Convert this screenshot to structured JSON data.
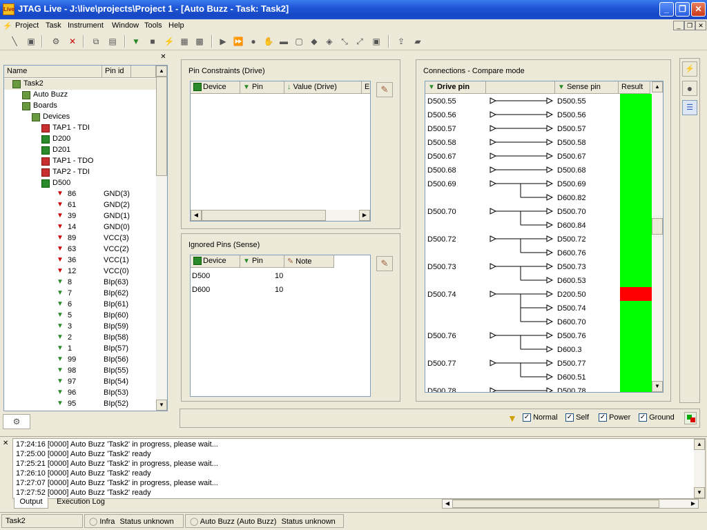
{
  "window": {
    "title": "JTAG Live - J:\\live\\projects\\Project 1 - [Auto Buzz - Task: Task2]",
    "logo": "Live",
    "minimize": "_",
    "restore": "❐",
    "close": "✕"
  },
  "menu": [
    "Project",
    "Task",
    "Instrument",
    "Window",
    "Tools",
    "Help"
  ],
  "tree": {
    "columns": [
      "Name",
      "Pin id"
    ],
    "rows": [
      {
        "label": "Task2",
        "pin": "",
        "level": 0,
        "icon": "task-icon"
      },
      {
        "label": "Auto Buzz",
        "pin": "",
        "level": 1,
        "icon": "autobuzz-icon"
      },
      {
        "label": "Boards",
        "pin": "",
        "level": 1,
        "icon": "boards-icon"
      },
      {
        "label": "Devices",
        "pin": "",
        "level": 2,
        "icon": "devices-icon"
      },
      {
        "label": "TAP1 - TDI",
        "pin": "",
        "level": 3,
        "icon": "tap-icon"
      },
      {
        "label": "D200",
        "pin": "",
        "level": 3,
        "icon": "chip-icon"
      },
      {
        "label": "D201",
        "pin": "",
        "level": 3,
        "icon": "chip-icon"
      },
      {
        "label": "TAP1 - TDO",
        "pin": "",
        "level": 3,
        "icon": "tap-icon"
      },
      {
        "label": "TAP2 - TDI",
        "pin": "",
        "level": 3,
        "icon": "tap-icon"
      },
      {
        "label": "D500",
        "pin": "",
        "level": 3,
        "icon": "chip-icon"
      },
      {
        "label": "86",
        "pin": "GND(3)",
        "level": 4,
        "icon": "pin-red-icon"
      },
      {
        "label": "61",
        "pin": "GND(2)",
        "level": 4,
        "icon": "pin-red-icon"
      },
      {
        "label": "39",
        "pin": "GND(1)",
        "level": 4,
        "icon": "pin-red-icon"
      },
      {
        "label": "14",
        "pin": "GND(0)",
        "level": 4,
        "icon": "pin-red-icon"
      },
      {
        "label": "89",
        "pin": "VCC(3)",
        "level": 4,
        "icon": "pin-red-icon"
      },
      {
        "label": "63",
        "pin": "VCC(2)",
        "level": 4,
        "icon": "pin-red-icon"
      },
      {
        "label": "36",
        "pin": "VCC(1)",
        "level": 4,
        "icon": "pin-red-icon"
      },
      {
        "label": "12",
        "pin": "VCC(0)",
        "level": 4,
        "icon": "pin-red-icon"
      },
      {
        "label": "8",
        "pin": "BIp(63)",
        "level": 4,
        "icon": "pin-green-icon"
      },
      {
        "label": "7",
        "pin": "BIp(62)",
        "level": 4,
        "icon": "pin-green-icon"
      },
      {
        "label": "6",
        "pin": "BIp(61)",
        "level": 4,
        "icon": "pin-green-icon"
      },
      {
        "label": "5",
        "pin": "BIp(60)",
        "level": 4,
        "icon": "pin-green-icon"
      },
      {
        "label": "3",
        "pin": "BIp(59)",
        "level": 4,
        "icon": "pin-green-icon"
      },
      {
        "label": "2",
        "pin": "BIp(58)",
        "level": 4,
        "icon": "pin-green-icon"
      },
      {
        "label": "1",
        "pin": "BIp(57)",
        "level": 4,
        "icon": "pin-green-icon"
      },
      {
        "label": "99",
        "pin": "BIp(56)",
        "level": 4,
        "icon": "pin-green-icon"
      },
      {
        "label": "98",
        "pin": "BIp(55)",
        "level": 4,
        "icon": "pin-green-icon"
      },
      {
        "label": "97",
        "pin": "BIp(54)",
        "level": 4,
        "icon": "pin-green-icon"
      },
      {
        "label": "96",
        "pin": "BIp(53)",
        "level": 4,
        "icon": "pin-green-icon"
      },
      {
        "label": "95",
        "pin": "BIp(52)",
        "level": 4,
        "icon": "pin-green-icon"
      }
    ]
  },
  "pin_constraints": {
    "title": "Pin Constraints (Drive)",
    "columns": [
      "Device",
      "Pin",
      "Value (Drive)",
      "E"
    ]
  },
  "ignored_pins": {
    "title": "Ignored Pins (Sense)",
    "columns": [
      "Device",
      "Pin",
      "Note"
    ],
    "rows": [
      {
        "device": "D500",
        "pin": "10",
        "note": ""
      },
      {
        "device": "D600",
        "pin": "10",
        "note": ""
      }
    ]
  },
  "connections": {
    "title": "Connections - Compare mode",
    "columns": [
      "Drive pin",
      "Sense pin",
      "Result"
    ],
    "groups": [
      {
        "drive": "D500.55",
        "senses": [
          "D500.55"
        ],
        "results": [
          "pass"
        ]
      },
      {
        "drive": "D500.56",
        "senses": [
          "D500.56"
        ],
        "results": [
          "pass"
        ]
      },
      {
        "drive": "D500.57",
        "senses": [
          "D500.57"
        ],
        "results": [
          "pass"
        ]
      },
      {
        "drive": "D500.58",
        "senses": [
          "D500.58"
        ],
        "results": [
          "pass"
        ]
      },
      {
        "drive": "D500.67",
        "senses": [
          "D500.67"
        ],
        "results": [
          "pass"
        ]
      },
      {
        "drive": "D500.68",
        "senses": [
          "D500.68"
        ],
        "results": [
          "pass"
        ]
      },
      {
        "drive": "D500.69",
        "senses": [
          "D500.69",
          "D600.82"
        ],
        "results": [
          "pass",
          "pass"
        ]
      },
      {
        "drive": "D500.70",
        "senses": [
          "D500.70",
          "D600.84"
        ],
        "results": [
          "pass",
          "pass"
        ]
      },
      {
        "drive": "D500.72",
        "senses": [
          "D500.72",
          "D600.76"
        ],
        "results": [
          "pass",
          "pass"
        ]
      },
      {
        "drive": "D500.73",
        "senses": [
          "D500.73",
          "D600.53"
        ],
        "results": [
          "pass",
          "pass"
        ]
      },
      {
        "drive": "D500.74",
        "senses": [
          "D200.50",
          "D500.74",
          "D600.70"
        ],
        "results": [
          "fail",
          "pass",
          "pass"
        ]
      },
      {
        "drive": "D500.76",
        "senses": [
          "D500.76",
          "D600.3"
        ],
        "results": [
          "pass",
          "pass"
        ]
      },
      {
        "drive": "D500.77",
        "senses": [
          "D500.77",
          "D600.51"
        ],
        "results": [
          "pass",
          "pass"
        ]
      },
      {
        "drive": "D500.78",
        "senses": [
          "D500.78"
        ],
        "results": [
          "pass"
        ]
      }
    ],
    "colors": {
      "pass": "#00ff00",
      "fail": "#ff0000"
    }
  },
  "filters": [
    {
      "label": "Normal",
      "checked": true
    },
    {
      "label": "Self",
      "checked": true
    },
    {
      "label": "Power",
      "checked": true
    },
    {
      "label": "Ground",
      "checked": true
    }
  ],
  "log": {
    "lines": [
      "17:24:16 [0000] Auto Buzz 'Task2' in progress, please wait...",
      "17:25:00 [0000] Auto Buzz 'Task2' ready",
      "17:25:21 [0000] Auto Buzz 'Task2' in progress, please wait...",
      "17:26:10 [0000] Auto Buzz 'Task2' ready",
      "17:27:07 [0000] Auto Buzz 'Task2' in progress, please wait...",
      "17:27:52 [0000] Auto Buzz 'Task2' ready"
    ],
    "tabs": [
      "Output",
      "Execution Log"
    ]
  },
  "statusbar": {
    "task": "Task2",
    "infra_label": "Infra",
    "infra_status": "Status unknown",
    "autobuzz_label": "Auto Buzz (Auto Buzz)",
    "autobuzz_status": "Status unknown"
  }
}
